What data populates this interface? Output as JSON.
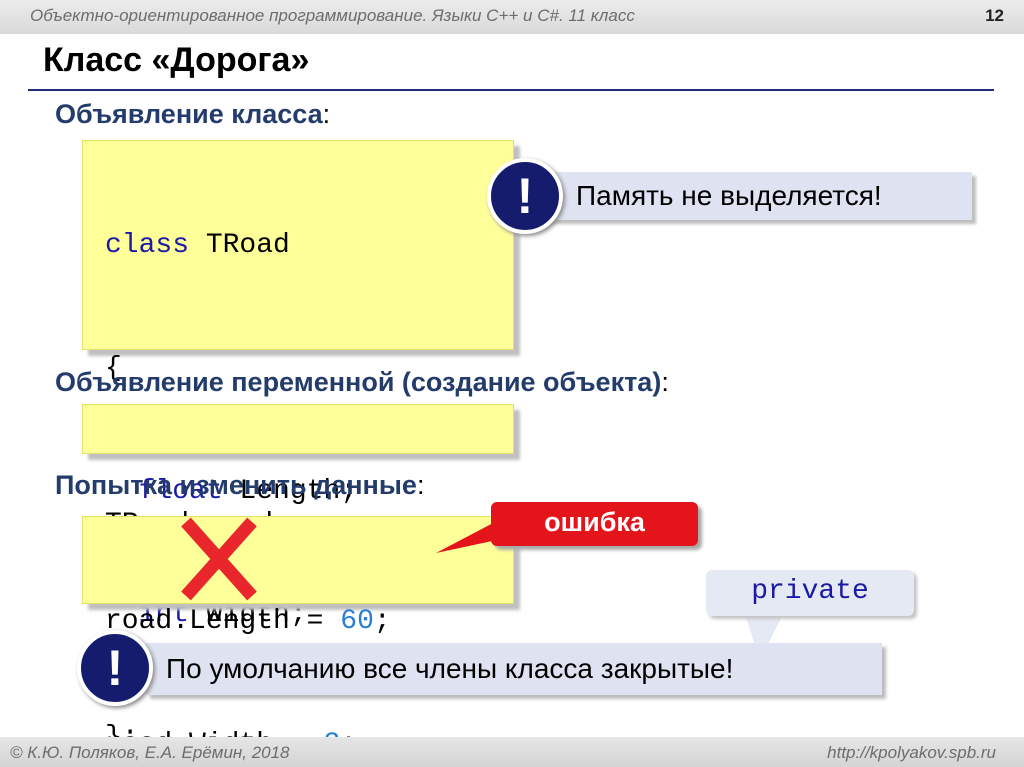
{
  "header": {
    "course": "Объектно-ориентированное программирование. Языки C++ и C#. 11 класс",
    "slide_number": "12"
  },
  "title": "Класс «Дорога»",
  "sections": {
    "class_declaration": "Объявление класса",
    "variable_declaration": "Объявление переменной (создание объекта)",
    "modify_attempt": "Попытка изменить данные",
    "colon": ":"
  },
  "code": {
    "class_block": [
      {
        "kw": "class",
        "rest": " TRoad"
      },
      {
        "kw": "",
        "rest": "{"
      },
      {
        "kw": "float",
        "rest": " Length;",
        "indent": "  "
      },
      {
        "kw": "int",
        "rest": " Width;",
        "indent": "  "
      },
      {
        "kw": "",
        "rest": "};"
      }
    ],
    "variable_line": "TRoad road;",
    "assign_lines": [
      {
        "lhs": "road.Length",
        "op": " = ",
        "value": "60",
        "end": ";"
      },
      {
        "lhs": "road.Width",
        "op": " = ",
        "value": "3",
        "end": ";"
      }
    ]
  },
  "notes": {
    "memory": "Память не выделяется!",
    "default_private": "По умолчанию все члены класса закрытые!",
    "exclamation": "!"
  },
  "callouts": {
    "error": "ошибка",
    "private": "private"
  },
  "footer": {
    "authors": "© К.Ю. Поляков, Е.А. Ерёмин, 2018",
    "site": "http://kpolyakov.spb.ru"
  },
  "colors": {
    "header_navy": "#243c6b",
    "keyword_blue": "#1a1aa6",
    "number_blue": "#2a7fd4",
    "code_bg": "#ffff9a",
    "error_red": "#e4141b",
    "note_bg": "#dfe2f0",
    "cross_red": "#e8262b"
  },
  "icons": [
    "exclamation-icon",
    "cross-mark-icon"
  ]
}
